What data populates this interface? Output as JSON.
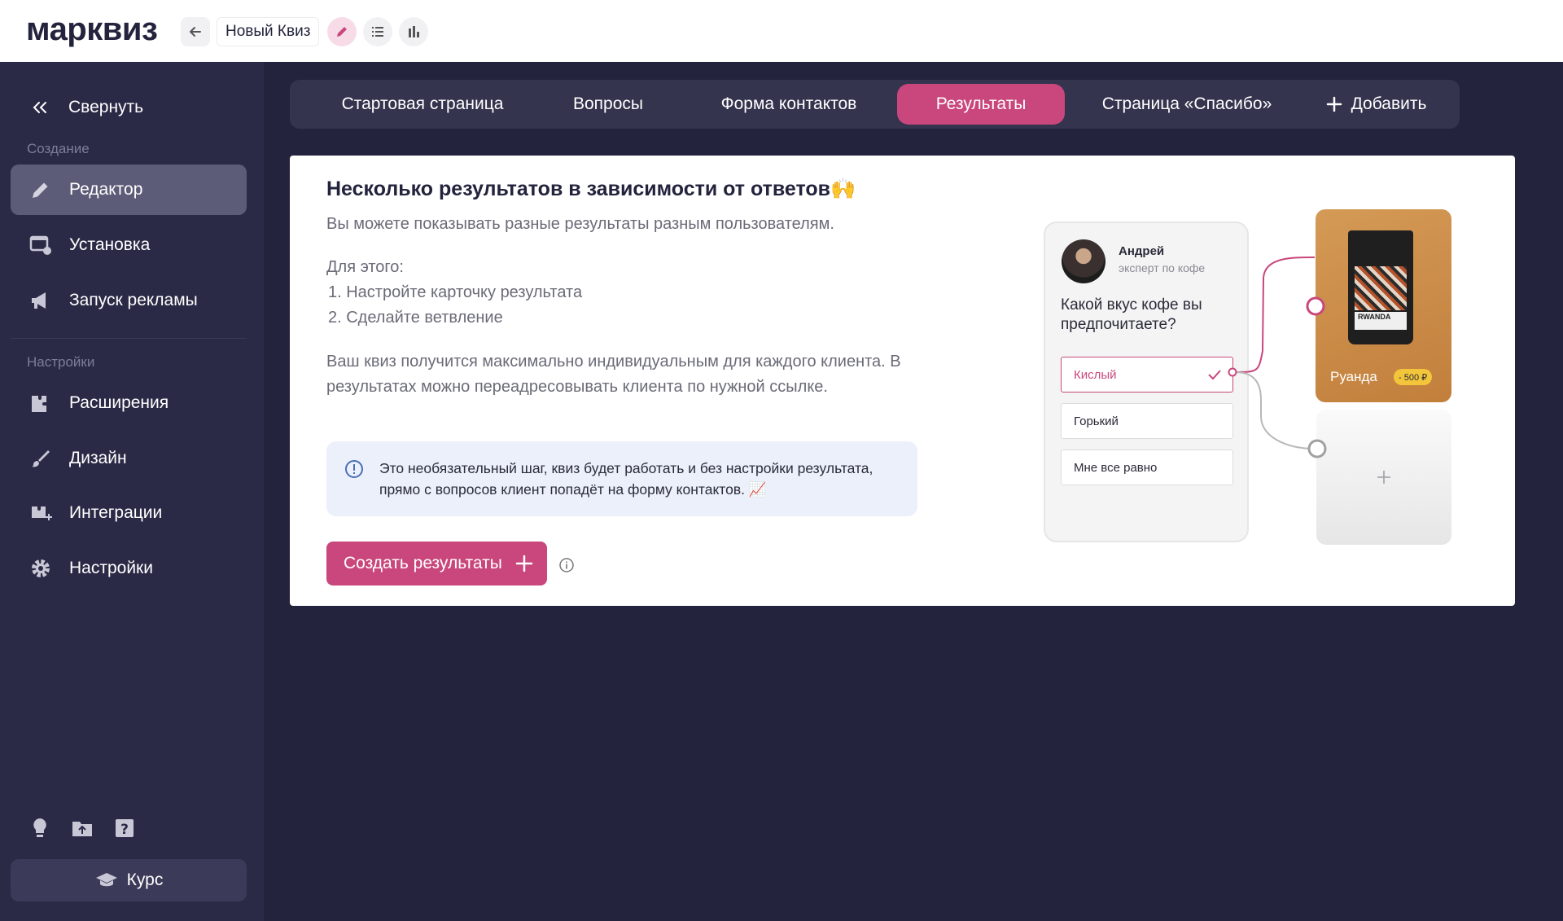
{
  "app": {
    "logo": "марквиз",
    "quiz_title": "Новый Квиз"
  },
  "sidebar": {
    "collapse_label": "Свернуть",
    "section_create": "Создание",
    "section_settings": "Настройки",
    "items": [
      {
        "label": "Редактор",
        "icon": "pencil-icon",
        "active": true
      },
      {
        "label": "Установка",
        "icon": "install-icon"
      },
      {
        "label": "Запуск рекламы",
        "icon": "megaphone-icon"
      },
      {
        "label": "Расширения",
        "icon": "extensions-icon"
      },
      {
        "label": "Дизайн",
        "icon": "brush-icon"
      },
      {
        "label": "Интеграции",
        "icon": "integrations-icon"
      },
      {
        "label": "Настройки",
        "icon": "gear-icon"
      }
    ],
    "bottom_icons": [
      "lightbulb-icon",
      "folder-upload-icon",
      "help-icon"
    ],
    "course_label": "Курс"
  },
  "tabs": [
    {
      "label": "Стартовая страница"
    },
    {
      "label": "Вопросы"
    },
    {
      "label": "Форма контактов"
    },
    {
      "label": "Результаты",
      "active": true
    },
    {
      "label": "Страница «Спасибо»"
    },
    {
      "label": "Добавить"
    }
  ],
  "content": {
    "title": "Несколько результатов в зависимости от ответов🙌",
    "subtitle": "Вы можете показывать разные результаты разным пользователям.",
    "steps_intro": "Для этого:",
    "step1": "1. Настройте карточку результата",
    "step2": "2. Сделайте ветвление",
    "paragraph": "Ваш квиз получится максимально индивидуальным для каждого клиента. В результатах можно переадресовывать клиента по нужной ссылке.",
    "info": "Это необязательный шаг, квиз будет работать и без настройки результата, прямо с вопросов клиент попадёт на форму контактов. 📈",
    "create_button": "Создать результаты"
  },
  "illustration": {
    "expert_name": "Андрей",
    "expert_role": "эксперт по кофе",
    "question": "Какой вкус кофе вы предпочитаете?",
    "options": [
      "Кислый",
      "Горький",
      "Мне все равно"
    ],
    "selected_option": "Кислый",
    "result_name": "Руанда",
    "result_price": "- 500 ₽",
    "bag_label": "RWANDA"
  },
  "colors": {
    "accent": "#c9477c",
    "sidebar": "#2a2a47",
    "background": "#23233d"
  }
}
